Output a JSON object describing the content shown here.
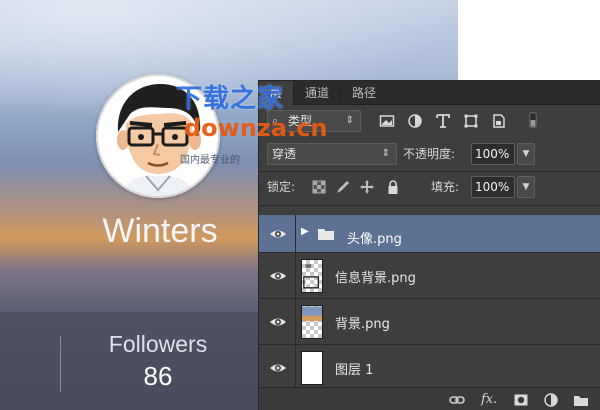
{
  "profile_card": {
    "username": "Winters",
    "followers_label": "Followers",
    "followers_count": "86"
  },
  "layers_panel": {
    "tabs": [
      {
        "label": "层",
        "active": true
      },
      {
        "label": "通道",
        "active": false
      },
      {
        "label": "路径",
        "active": false
      }
    ],
    "filter": {
      "kind_value": "类型",
      "icons": [
        "image-filter-icon",
        "adjustment-filter-icon",
        "type-filter-icon",
        "shape-filter-icon",
        "smart-object-filter-icon",
        "filter-toggle-icon"
      ]
    },
    "blend_mode": "穿透",
    "opacity_label": "不透明度:",
    "opacity_value": "100%",
    "lock_label": "锁定:",
    "lock_icons": [
      "lock-transparent-pixels-icon",
      "lock-image-pixels-icon",
      "lock-position-icon",
      "lock-all-icon"
    ],
    "fill_label": "填充:",
    "fill_value": "100%",
    "layers": [
      {
        "name": "头像.png",
        "type": "group",
        "visible": true,
        "selected": true
      },
      {
        "name": "信息背景.png",
        "type": "image",
        "visible": true,
        "selected": false
      },
      {
        "name": "背景.png",
        "type": "image",
        "visible": true,
        "selected": false
      },
      {
        "name": "图层 1",
        "type": "image",
        "visible": true,
        "selected": false
      }
    ],
    "bottom_icons": [
      "link-layers-icon",
      "fx-icon",
      "add-mask-icon",
      "adjustment-layer-icon",
      "new-group-icon"
    ],
    "fx_label": "fx."
  },
  "watermark": {
    "logo": "下载之家",
    "url": "downza.cn",
    "slogan": "国内最专业的"
  },
  "colors": {
    "panel_bg": "#3e3e3e",
    "selected_layer": "#5c7193",
    "watermark_blue": "#2f6fe0",
    "watermark_orange": "#e65b12"
  }
}
